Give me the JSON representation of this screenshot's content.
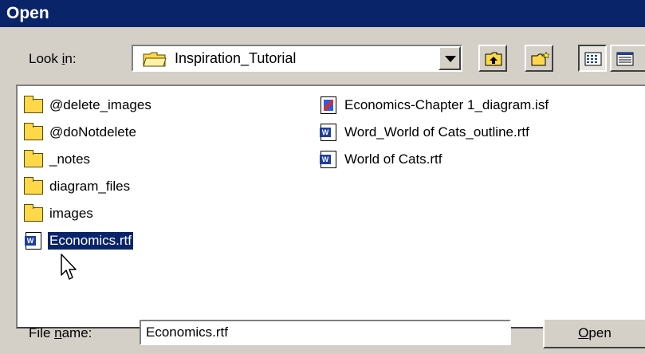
{
  "window": {
    "title": "Open"
  },
  "lookin": {
    "label_pre": "Look ",
    "label_accel": "i",
    "label_post": "n:",
    "value": "Inspiration_Tutorial"
  },
  "files": [
    {
      "name": "@delete_images",
      "type": "folder"
    },
    {
      "name": "@doNotdelete",
      "type": "folder"
    },
    {
      "name": "_notes",
      "type": "folder"
    },
    {
      "name": "diagram_files",
      "type": "folder"
    },
    {
      "name": "images",
      "type": "folder"
    },
    {
      "name": "Economics.rtf",
      "type": "word-doc",
      "selected": true
    },
    {
      "name": "Economics-Chapter 1_diagram.isf",
      "type": "inspiration-doc"
    },
    {
      "name": "Word_World of Cats_outline.rtf",
      "type": "word-doc"
    },
    {
      "name": "World of Cats.rtf",
      "type": "word-doc"
    }
  ],
  "filename": {
    "label_pre": "File ",
    "label_accel": "n",
    "label_post": "ame:",
    "value": "Economics.rtf"
  },
  "open_button": {
    "accel": "O",
    "rest": "pen"
  },
  "icons": {
    "up_folder": "up-folder-icon",
    "new_folder": "new-folder-icon",
    "list_view": "list-view-icon",
    "details_view": "details-view-icon",
    "cursor": "mouse-pointer-icon"
  },
  "colors": {
    "title_bar": "#0a246a",
    "selection": "#0a246a",
    "dialog_bg": "#d4d0c8"
  }
}
